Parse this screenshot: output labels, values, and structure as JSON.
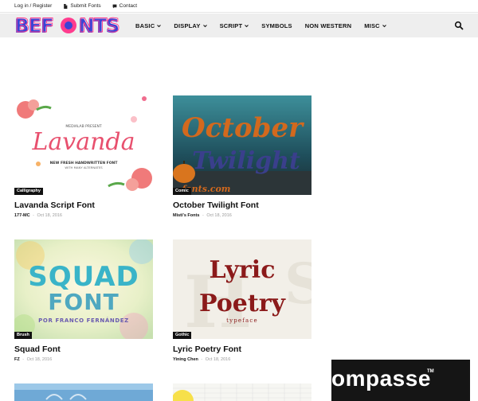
{
  "topbar": {
    "login": "Log in / Register",
    "submit": "Submit Fonts",
    "contact": "Contact"
  },
  "logo": {
    "text": "BEFONTS"
  },
  "nav": {
    "items": [
      {
        "label": "BASIC",
        "dropdown": true
      },
      {
        "label": "DISPLAY",
        "dropdown": true
      },
      {
        "label": "SCRIPT",
        "dropdown": true
      },
      {
        "label": "SYMBOLS",
        "dropdown": false
      },
      {
        "label": "NON WESTERN",
        "dropdown": false
      },
      {
        "label": "MISC",
        "dropdown": true
      }
    ]
  },
  "cards": [
    {
      "title": "Lavanda Script Font",
      "category": "Calligraphy",
      "author": "177-MC",
      "date": "Oct 18, 2016",
      "thumb": {
        "kicker": "MEDIALAB PRESENT",
        "name": "Lavanda",
        "line1": "NEW FRESH HANDWRITTEN FONT",
        "line2": "WITH MANY ALTERNATES"
      }
    },
    {
      "title": "October Twilight Font",
      "category": "Comic",
      "author": "Misti's Fonts",
      "date": "Oct 18, 2016",
      "thumb": {
        "word1": "October",
        "word2": "Twilight",
        "watermark": "fonts.com"
      }
    },
    {
      "title": "Squad Font",
      "category": "Brush",
      "author": "FZ",
      "date": "Oct 18, 2016",
      "thumb": {
        "word1": "SQUAD",
        "word2": "FONT",
        "byline": "POR FRANCO FERNÁNDEZ"
      }
    },
    {
      "title": "Lyric Poetry Font",
      "category": "Gothic",
      "author": "Yining Chen",
      "date": "Oct 18, 2016",
      "thumb": {
        "word1": "Lyric",
        "word2": "Poetry",
        "sub": "typeface"
      }
    }
  ],
  "ad": {
    "text": "ompasse",
    "tm": "TM"
  },
  "colors": {
    "navbar_bg": "#eeeeee",
    "tag_bg": "#111111",
    "october_title": "#d2691e",
    "lyric_red": "#8b1a1a",
    "squad_teal": "#3ab4c8"
  }
}
